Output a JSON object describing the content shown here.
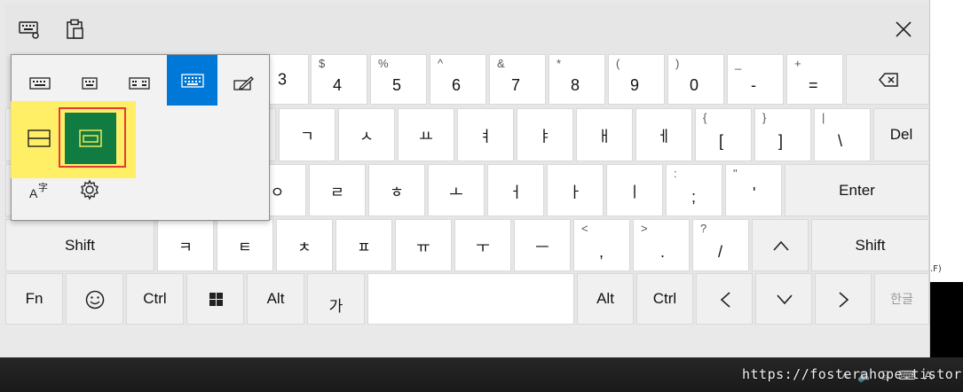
{
  "watermark": "https://fosterahope.tistory.com",
  "clipped_text": ".F)",
  "taskbar": {
    "tray_icons": [
      "chevron-up-icon",
      "speaker-icon",
      "network-icon",
      "keyboard-icon"
    ],
    "tray_text": "A"
  },
  "toolbar": {
    "settings_icon": "keyboard-settings-icon",
    "clipboard_icon": "clipboard-icon",
    "close_icon": "close-icon"
  },
  "mode_menu": {
    "layouts": [
      "default-layout-icon",
      "small-layout-icon",
      "split-layout-icon",
      "full-keyboard-icon",
      "handwriting-icon"
    ],
    "selected_layout": "full-keyboard-icon",
    "dock_modes": [
      "docked-icon",
      "undocked-icon"
    ],
    "selected_dock": "undocked-icon",
    "language_icon": "language-icon",
    "settings_icon": "gear-icon"
  },
  "rows": {
    "number": [
      {
        "main": "3"
      },
      {
        "main": "4",
        "shift": "$"
      },
      {
        "main": "5",
        "shift": "%"
      },
      {
        "main": "6",
        "shift": "^"
      },
      {
        "main": "7",
        "shift": "&"
      },
      {
        "main": "8",
        "shift": "*"
      },
      {
        "main": "9",
        "shift": "("
      },
      {
        "main": "0",
        "shift": ")"
      },
      {
        "main": "-",
        "shift": "_"
      },
      {
        "main": "=",
        "shift": "+"
      }
    ],
    "backspace_icon": "backspace-icon",
    "top": [
      "ㄱ",
      "ㅅ",
      "ㅛ",
      "ㅕ",
      "ㅑ",
      "ㅐ",
      "ㅔ"
    ],
    "top_brackets": [
      {
        "main": "[",
        "shift": "{"
      },
      {
        "main": "]",
        "shift": "}"
      },
      {
        "main": "\\",
        "shift": "|"
      }
    ],
    "del_label": "Del",
    "home": [
      "ㅇ",
      "ㄹ",
      "ㅎ",
      "ㅗ",
      "ㅓ",
      "ㅏ",
      "ㅣ"
    ],
    "home_punct": [
      {
        "main": ";",
        "shift": ":"
      },
      {
        "main": "'",
        "shift": "\""
      }
    ],
    "enter_label": "Enter",
    "shift_label": "Shift",
    "bottom": [
      "ㅋ",
      "ㅌ",
      "ㅊ",
      "ㅍ",
      "ㅠ",
      "ㅜ",
      "ㅡ"
    ],
    "bottom_punct": [
      {
        "main": ",",
        "shift": "<"
      },
      {
        "main": ".",
        "shift": ">"
      },
      {
        "main": "/",
        "shift": "?"
      }
    ],
    "space": {
      "fn": "Fn",
      "ctrl": "Ctrl",
      "alt": "Alt",
      "hanja": "가",
      "alt_right": "Alt",
      "ctrl_right": "Ctrl",
      "ime": "한글"
    }
  }
}
